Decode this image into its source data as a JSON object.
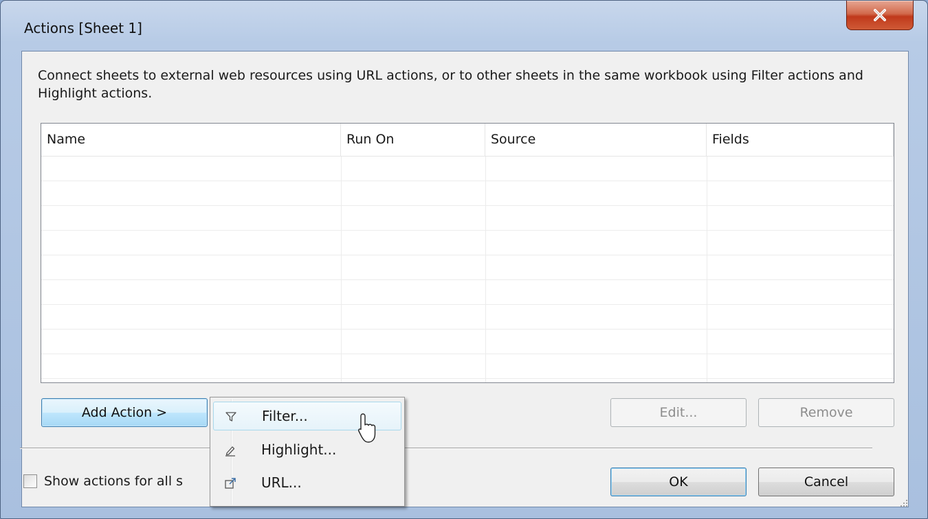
{
  "window": {
    "title": "Actions [Sheet 1]"
  },
  "description": "Connect sheets to external web resources using URL actions, or to other sheets in the same workbook using Filter actions and Highlight actions.",
  "table": {
    "columns": [
      "Name",
      "Run On",
      "Source",
      "Fields"
    ],
    "rows": []
  },
  "buttons": {
    "add_action": "Add Action >",
    "edit": "Edit...",
    "remove": "Remove",
    "ok": "OK",
    "cancel": "Cancel"
  },
  "checkbox": {
    "label": "Show actions for all s",
    "checked": false
  },
  "menu": {
    "items": [
      {
        "label": "Filter...",
        "icon": "filter-icon",
        "hovered": true
      },
      {
        "label": "Highlight...",
        "icon": "highlight-icon",
        "hovered": false
      },
      {
        "label": "URL...",
        "icon": "url-icon",
        "hovered": false
      }
    ]
  },
  "colors": {
    "close_button": "#c0391b",
    "primary_button_border": "#3c7fb1"
  }
}
